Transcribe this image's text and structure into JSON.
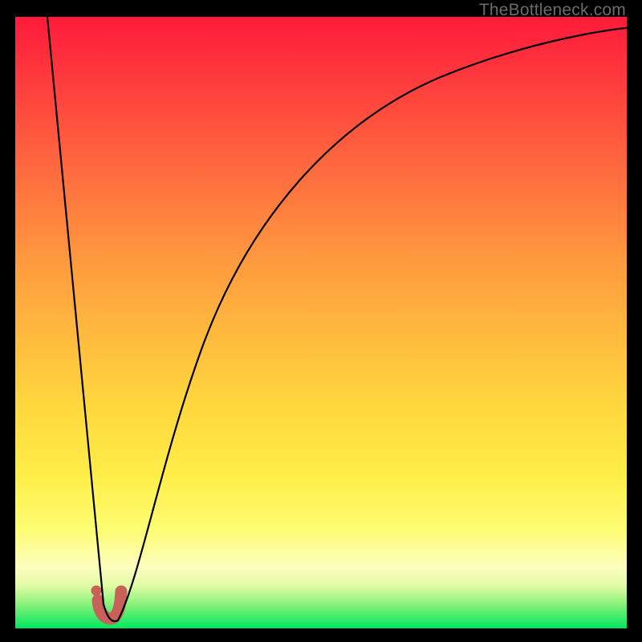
{
  "watermark": "TheBottleneck.com",
  "chart_data": {
    "type": "line",
    "title": "",
    "xlabel": "",
    "ylabel": "",
    "xlim": [
      0,
      100
    ],
    "ylim": [
      0,
      100
    ],
    "legend": false,
    "grid": false,
    "note": "Plot area is a square with a vertical red→orange→yellow→green gradient (red at top, green at bottom). A single black curve descends steeply from the top-left, reaches a minimum near x≈14–17, then rises and asymptotically levels toward the top-right. A small salmon J-shaped marker with a dot sits at the curve minimum. No axis ticks, labels or gridlines are visible.",
    "background_gradient": {
      "direction": "top-to-bottom",
      "stops": [
        {
          "pos": 0.0,
          "color": "#ff1a3a"
        },
        {
          "pos": 0.25,
          "color": "#ff6a3e"
        },
        {
          "pos": 0.52,
          "color": "#ffba3e"
        },
        {
          "pos": 0.75,
          "color": "#ffee48"
        },
        {
          "pos": 0.9,
          "color": "#fdfdbe"
        },
        {
          "pos": 1.0,
          "color": "#00e85e"
        }
      ]
    },
    "series": [
      {
        "name": "bottleneck-curve",
        "color": "#000000",
        "x": [
          5,
          8,
          11,
          13,
          14,
          15,
          16,
          17,
          19,
          21,
          24,
          28,
          33,
          40,
          48,
          58,
          70,
          85,
          100
        ],
        "y": [
          100,
          70,
          40,
          20,
          8,
          3,
          3,
          5,
          18,
          30,
          45,
          58,
          70,
          80,
          87,
          92,
          95,
          97,
          98
        ]
      }
    ],
    "sweet_spot": {
      "color": "#c86159",
      "dot": {
        "x": 13.2,
        "y": 7
      },
      "j_path": [
        {
          "x": 13.5,
          "y": 5
        },
        {
          "x": 13.8,
          "y": 2
        },
        {
          "x": 15.5,
          "y": 1.5
        },
        {
          "x": 17.0,
          "y": 2.2
        },
        {
          "x": 17.3,
          "y": 5.5
        }
      ]
    }
  }
}
